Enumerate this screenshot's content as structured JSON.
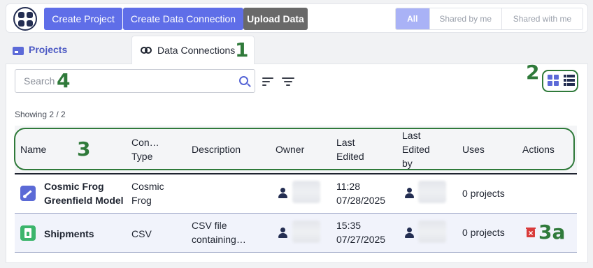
{
  "topbar": {
    "create_project": "Create Project",
    "create_data_connection": "Create Data Connection",
    "upload_data": "Upload Data",
    "filters": [
      "All",
      "Shared by me",
      "Shared with me"
    ]
  },
  "tabs": {
    "projects": "Projects",
    "data_connections": "Data Connections"
  },
  "toolbar": {
    "search_placeholder": "Search",
    "showing": "Showing 2 / 2"
  },
  "table": {
    "headers": {
      "name": "Name",
      "type": "Con… Type",
      "description": "Description",
      "owner": "Owner",
      "last_edited": "Last Edited",
      "last_edited_by": "Last Edited by",
      "uses": "Uses",
      "actions": "Actions"
    },
    "rows": [
      {
        "name": "Cosmic Frog Greenfield Model",
        "type": "Cosmic Frog",
        "description": "",
        "last_edited_time": "11:28",
        "last_edited_date": "07/28/2025",
        "uses": "0 projects",
        "icon": "cosmic-frog-icon"
      },
      {
        "name": "Shipments",
        "type": "CSV",
        "description": "CSV file containing…",
        "last_edited_time": "15:35",
        "last_edited_date": "07/27/2025",
        "uses": "0 projects",
        "icon": "csv-file-icon"
      }
    ]
  },
  "callouts": [
    "1",
    "2",
    "3",
    "4",
    "3a"
  ],
  "colors": {
    "accent": "#5f6ee8",
    "annotation_green": "#2f7a3a",
    "delete_red": "#d93b3b"
  }
}
